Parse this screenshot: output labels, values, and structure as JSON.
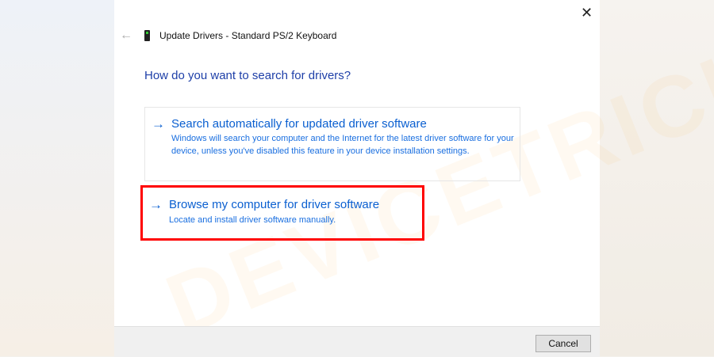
{
  "window": {
    "title": "Update Drivers - Standard PS/2 Keyboard",
    "close_icon": "close-icon",
    "back_icon": "back-arrow-icon",
    "device_icon": "keyboard-device-icon"
  },
  "heading": "How do you want to search for drivers?",
  "options": [
    {
      "title": "Search automatically for updated driver software",
      "description": "Windows will search your computer and the Internet for the latest driver software for your device, unless you've disabled this feature in your device installation settings.",
      "icon": "arrow-right-icon"
    },
    {
      "title": "Browse my computer for driver software",
      "description": "Locate and install driver software manually.",
      "icon": "arrow-right-icon",
      "highlighted": true,
      "highlight_color": "#ff0000"
    }
  ],
  "footer": {
    "cancel_label": "Cancel"
  },
  "watermark": "DEVICETRICKS"
}
